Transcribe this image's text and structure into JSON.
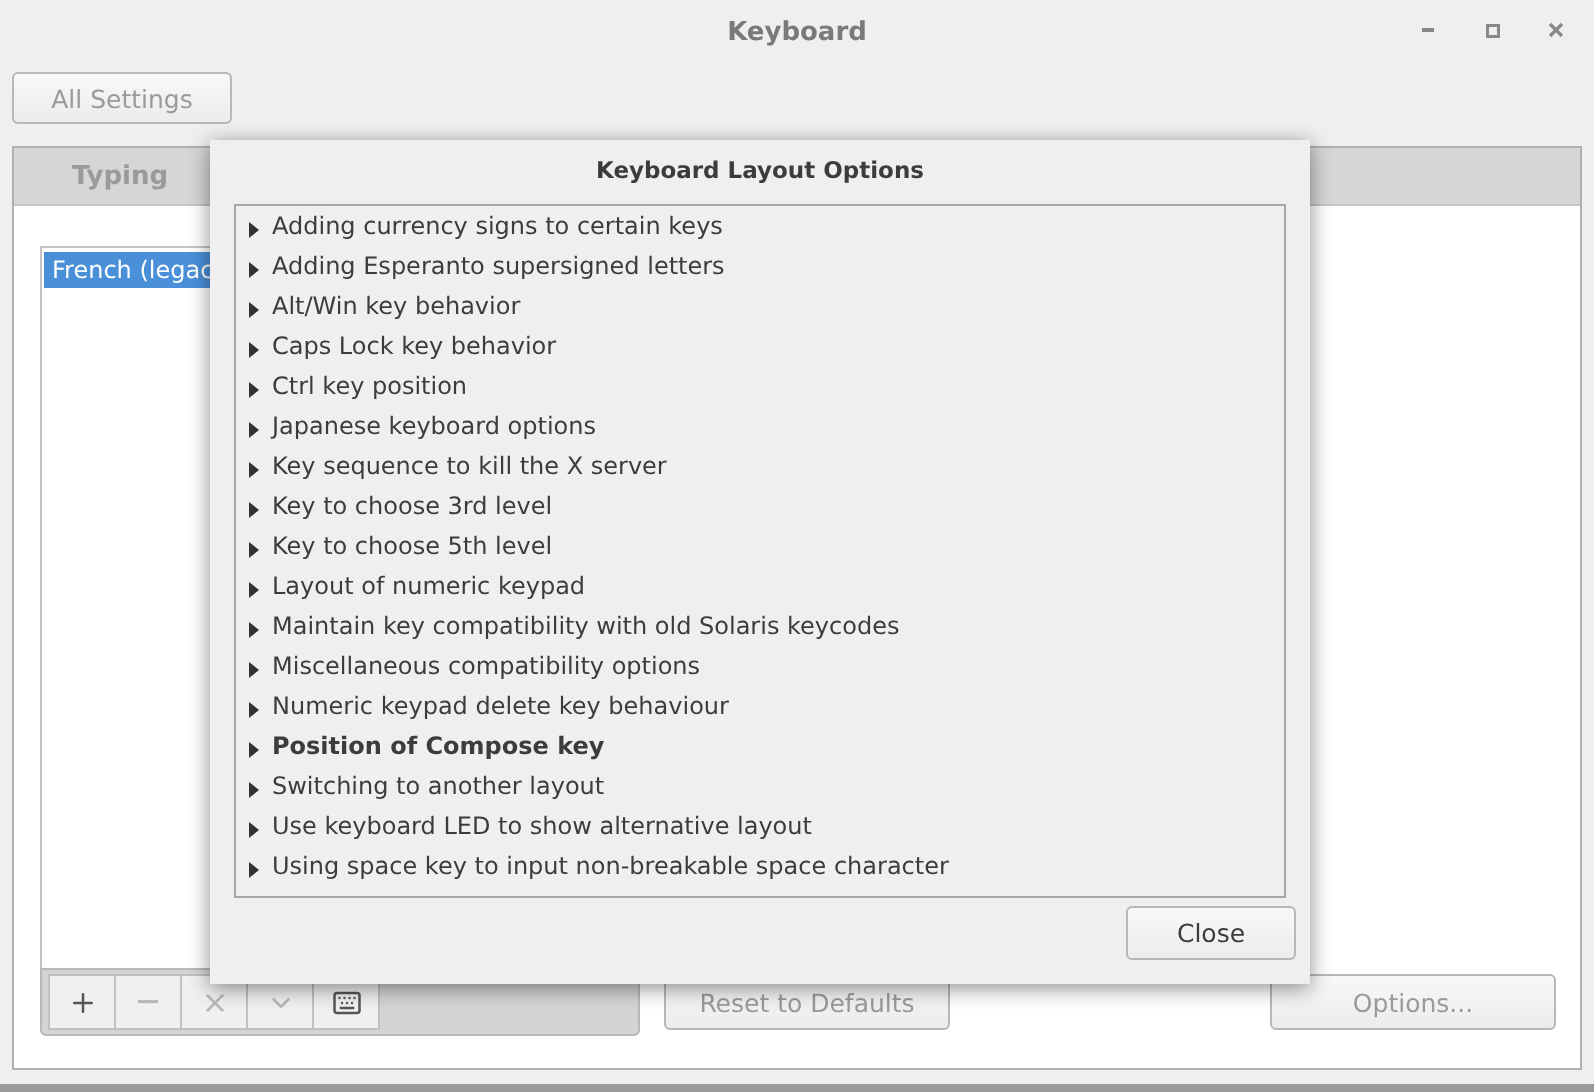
{
  "window": {
    "title": "Keyboard"
  },
  "all_settings_button": "All Settings",
  "tabs": [
    {
      "label": "Typing",
      "selected": false
    }
  ],
  "layouts": [
    {
      "label": "French (legac",
      "selected": true
    }
  ],
  "layout_toolbar": [
    {
      "kind": "add",
      "disabled": false
    },
    {
      "kind": "remove",
      "disabled": true
    },
    {
      "kind": "clear",
      "disabled": true
    },
    {
      "kind": "down",
      "disabled": true
    },
    {
      "kind": "keyboard",
      "disabled": false
    }
  ],
  "reset_button": "Reset to Defaults",
  "options_button": "Options...",
  "dialog": {
    "title": "Keyboard Layout Options",
    "options": [
      {
        "label": "Adding currency signs to certain keys",
        "expanded": false,
        "modified": false
      },
      {
        "label": "Adding Esperanto supersigned letters",
        "expanded": false,
        "modified": false
      },
      {
        "label": "Alt/Win key behavior",
        "expanded": false,
        "modified": false
      },
      {
        "label": "Caps Lock key behavior",
        "expanded": false,
        "modified": false
      },
      {
        "label": "Ctrl key position",
        "expanded": false,
        "modified": false
      },
      {
        "label": "Japanese keyboard options",
        "expanded": false,
        "modified": false
      },
      {
        "label": "Key sequence to kill the X server",
        "expanded": false,
        "modified": false
      },
      {
        "label": "Key to choose 3rd level",
        "expanded": false,
        "modified": false
      },
      {
        "label": "Key to choose 5th level",
        "expanded": false,
        "modified": false
      },
      {
        "label": "Layout of numeric keypad",
        "expanded": false,
        "modified": false
      },
      {
        "label": "Maintain key compatibility with old Solaris keycodes",
        "expanded": false,
        "modified": false
      },
      {
        "label": "Miscellaneous compatibility options",
        "expanded": false,
        "modified": false
      },
      {
        "label": "Numeric keypad delete key behaviour",
        "expanded": false,
        "modified": false
      },
      {
        "label": "Position of Compose key",
        "expanded": false,
        "modified": true
      },
      {
        "label": "Switching to another layout",
        "expanded": false,
        "modified": false
      },
      {
        "label": "Use keyboard LED to show alternative layout",
        "expanded": false,
        "modified": false
      },
      {
        "label": "Using space key to input non-breakable space character",
        "expanded": false,
        "modified": false
      }
    ],
    "close_button": "Close"
  }
}
